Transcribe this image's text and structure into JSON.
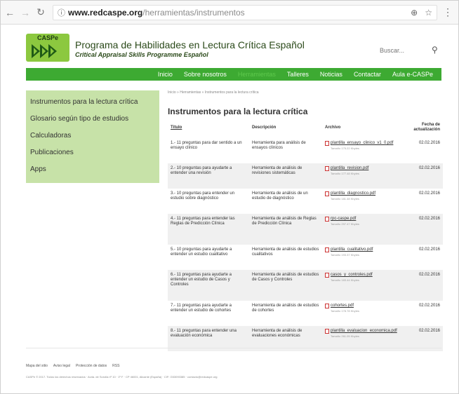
{
  "browser": {
    "url_domain": "www.redcaspe.org",
    "url_path": "/herramientas/instrumentos"
  },
  "header": {
    "logo_text": "CASPe",
    "title": "Programa de Habilidades en Lectura Crítica Español",
    "subtitle": "Critical Appraisal Skills Programme Español",
    "search_placeholder": "Buscar..."
  },
  "nav": {
    "items": [
      {
        "label": "Inicio"
      },
      {
        "label": "Sobre nosotros"
      },
      {
        "label": "Herramientas"
      },
      {
        "label": "Talleres"
      },
      {
        "label": "Noticias"
      },
      {
        "label": "Contactar"
      },
      {
        "label": "Aula e-CASPe"
      }
    ]
  },
  "sidebar": {
    "items": [
      {
        "label": "Instrumentos para la lectura crítica"
      },
      {
        "label": "Glosario según tipo de estudios"
      },
      {
        "label": "Calculadoras"
      },
      {
        "label": "Publicaciones"
      },
      {
        "label": "Apps"
      }
    ]
  },
  "main": {
    "breadcrumb": "Inicio » Herramientas » Instrumentos para la lectura crítica",
    "title": "Instrumentos para la lectura crítica",
    "columns": {
      "titulo": "Título",
      "descripcion": "Descripción",
      "archivo": "Archivo",
      "fecha": "Fecha de actualización"
    },
    "rows": [
      {
        "title": "1.- 11 preguntas para dar sentido a un ensayo clínico",
        "desc": "Herramienta para análisis de ensayos clínicos",
        "file": "plantilla_ensayo_clinico_v1_0.pdf",
        "size": "Tamaño 175.22 Kbytes",
        "date": "02.02.2016"
      },
      {
        "title": "2.- 10 preguntas para ayudarte a entender una revisión",
        "desc": "Herramienta de análisis de revisiones sistemáticas",
        "file": "plantilla_revision.pdf",
        "size": "Tamaño 177.48 Kbytes",
        "date": "02.02.2016"
      },
      {
        "title": "3.- 10 preguntas para entender un estudio sobre diagnóstico",
        "desc": "Herramienta de análisis de un estudio de diagnóstico",
        "file": "plantilla_diagnostico.pdf",
        "size": "Tamaño 181.48 Kbytes",
        "date": "02.02.2016"
      },
      {
        "title": "4.- 11 preguntas para entender las Reglas de Predicción Clínica",
        "desc": "Herramienta de análisis de Reglas de Predicción Clínica",
        "file": "rpc-caspe.pdf",
        "size": "Tamaño 297.47 Kbytes",
        "date": "02.02.2016"
      },
      {
        "title": "5.- 10 preguntas para ayudarte a entender un estudio cualitativo",
        "desc": "Herramienta de análisis de estudios cualitativos",
        "file": "plantilla_cualitativo.pdf",
        "size": "Tamaño 193.37 Kbytes",
        "date": "02.02.2016"
      },
      {
        "title": "6.- 11 preguntas para ayudarte a entender un estudio de Casos y Controles",
        "desc": "Herramienta de análisis de estudios de Casos y Controles",
        "file": "casos_y_controles.pdf",
        "size": "Tamaño 183.44 Kbytes",
        "date": "02.02.2016"
      },
      {
        "title": "7.- 11 preguntas para ayudarte a entender un estudio de cohortes",
        "desc": "Herramienta de análisis de estudios de cohortes",
        "file": "cohortes.pdf",
        "size": "Tamaño 178.78 Kbytes",
        "date": "02.02.2016"
      },
      {
        "title": "8.- 11 preguntas para entender una evaluación económica",
        "desc": "Herramienta de análisis de evaluaciones económicas",
        "file": "plantilla_evaluacion_economica.pdf",
        "size": "Tamaño 261.05 Kbytes",
        "date": "02.02.2016"
      }
    ]
  },
  "footer": {
    "links": [
      {
        "label": "Mapa del sitio"
      },
      {
        "label": "Aviso legal"
      },
      {
        "label": "Protección de datos"
      },
      {
        "label": "RSS"
      }
    ],
    "copyright": "CASPe © 2017. Todos los derechos reservados · Avda. de Sorolla nº 10 · 1º F · CP 46001, Alicante (España) · CIF: G53093385 · contacto@redcaspe.org"
  },
  "colors": {
    "nav_green": "#3daa32",
    "sidebar_green": "#c7e2a8",
    "logo_green": "#8cc83f"
  }
}
